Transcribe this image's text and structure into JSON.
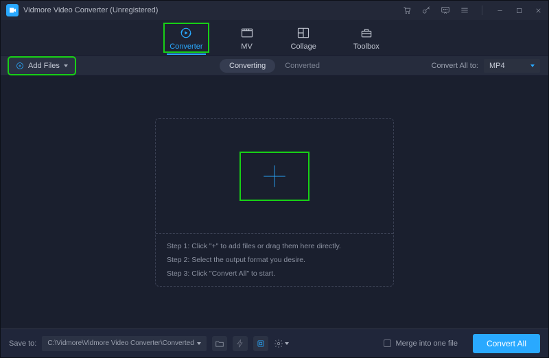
{
  "title": "Vidmore Video Converter (Unregistered)",
  "tabs": [
    {
      "label": "Converter",
      "icon": "converter-icon",
      "active": true
    },
    {
      "label": "MV",
      "icon": "mv-icon",
      "active": false
    },
    {
      "label": "Collage",
      "icon": "collage-icon",
      "active": false
    },
    {
      "label": "Toolbox",
      "icon": "toolbox-icon",
      "active": false
    }
  ],
  "toolbar": {
    "add_files_label": "Add Files",
    "subtab_converting": "Converting",
    "subtab_converted": "Converted",
    "convert_all_to_label": "Convert All to:",
    "format_value": "MP4"
  },
  "dropzone": {
    "step1": "Step 1: Click \"+\" to add files or drag them here directly.",
    "step2": "Step 2: Select the output format you desire.",
    "step3": "Step 3: Click \"Convert All\" to start."
  },
  "footer": {
    "save_to_label": "Save to:",
    "save_path": "C:\\Vidmore\\Vidmore Video Converter\\Converted",
    "merge_label": "Merge into one file",
    "convert_all_label": "Convert All"
  }
}
